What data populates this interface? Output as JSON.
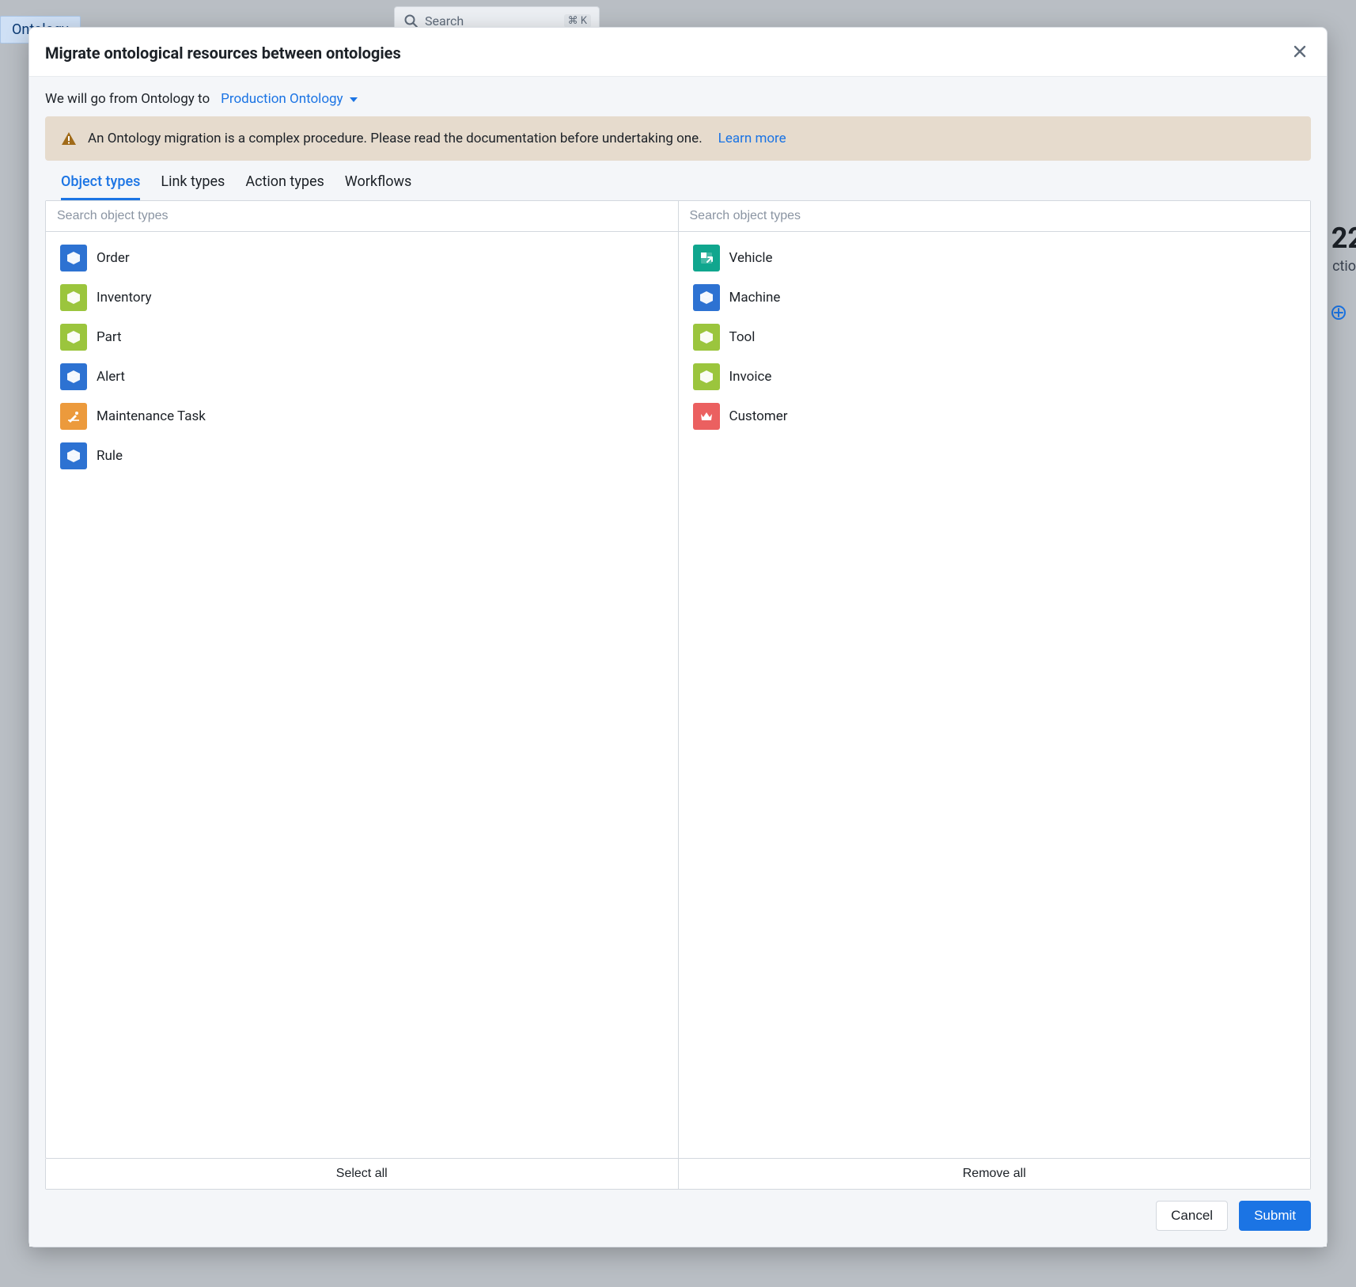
{
  "background": {
    "chip": "Ontology",
    "search_placeholder": "Search",
    "shortcut_key": "K",
    "truncated_number": "22",
    "truncated_text": "ction"
  },
  "dialog": {
    "title": "Migrate ontological resources between ontologies",
    "intro_prefix": "We will go from Ontology to",
    "destination": "Production Ontology",
    "warning_text": "An Ontology migration is a complex procedure. Please read the documentation before undertaking one.",
    "learn_more": "Learn more",
    "tabs": {
      "object_types": "Object types",
      "link_types": "Link types",
      "action_types": "Action types",
      "workflows": "Workflows"
    },
    "search_placeholder_left": "Search object types",
    "search_placeholder_right": "Search object types",
    "left_items": [
      {
        "label": "Order",
        "icon": "cube",
        "color": "blue"
      },
      {
        "label": "Inventory",
        "icon": "cube",
        "color": "lime"
      },
      {
        "label": "Part",
        "icon": "cube",
        "color": "lime"
      },
      {
        "label": "Alert",
        "icon": "cube",
        "color": "blue"
      },
      {
        "label": "Maintenance Task",
        "icon": "maintenance",
        "color": "orange"
      },
      {
        "label": "Rule",
        "icon": "cube",
        "color": "blue"
      }
    ],
    "right_items": [
      {
        "label": "Vehicle",
        "icon": "arrow-into-square",
        "color": "teal"
      },
      {
        "label": "Machine",
        "icon": "cube",
        "color": "blue"
      },
      {
        "label": "Tool",
        "icon": "cube",
        "color": "lime"
      },
      {
        "label": "Invoice",
        "icon": "cube",
        "color": "lime"
      },
      {
        "label": "Customer",
        "icon": "crown",
        "color": "coral"
      }
    ],
    "select_all": "Select all",
    "remove_all": "Remove all",
    "cancel": "Cancel",
    "submit": "Submit"
  }
}
